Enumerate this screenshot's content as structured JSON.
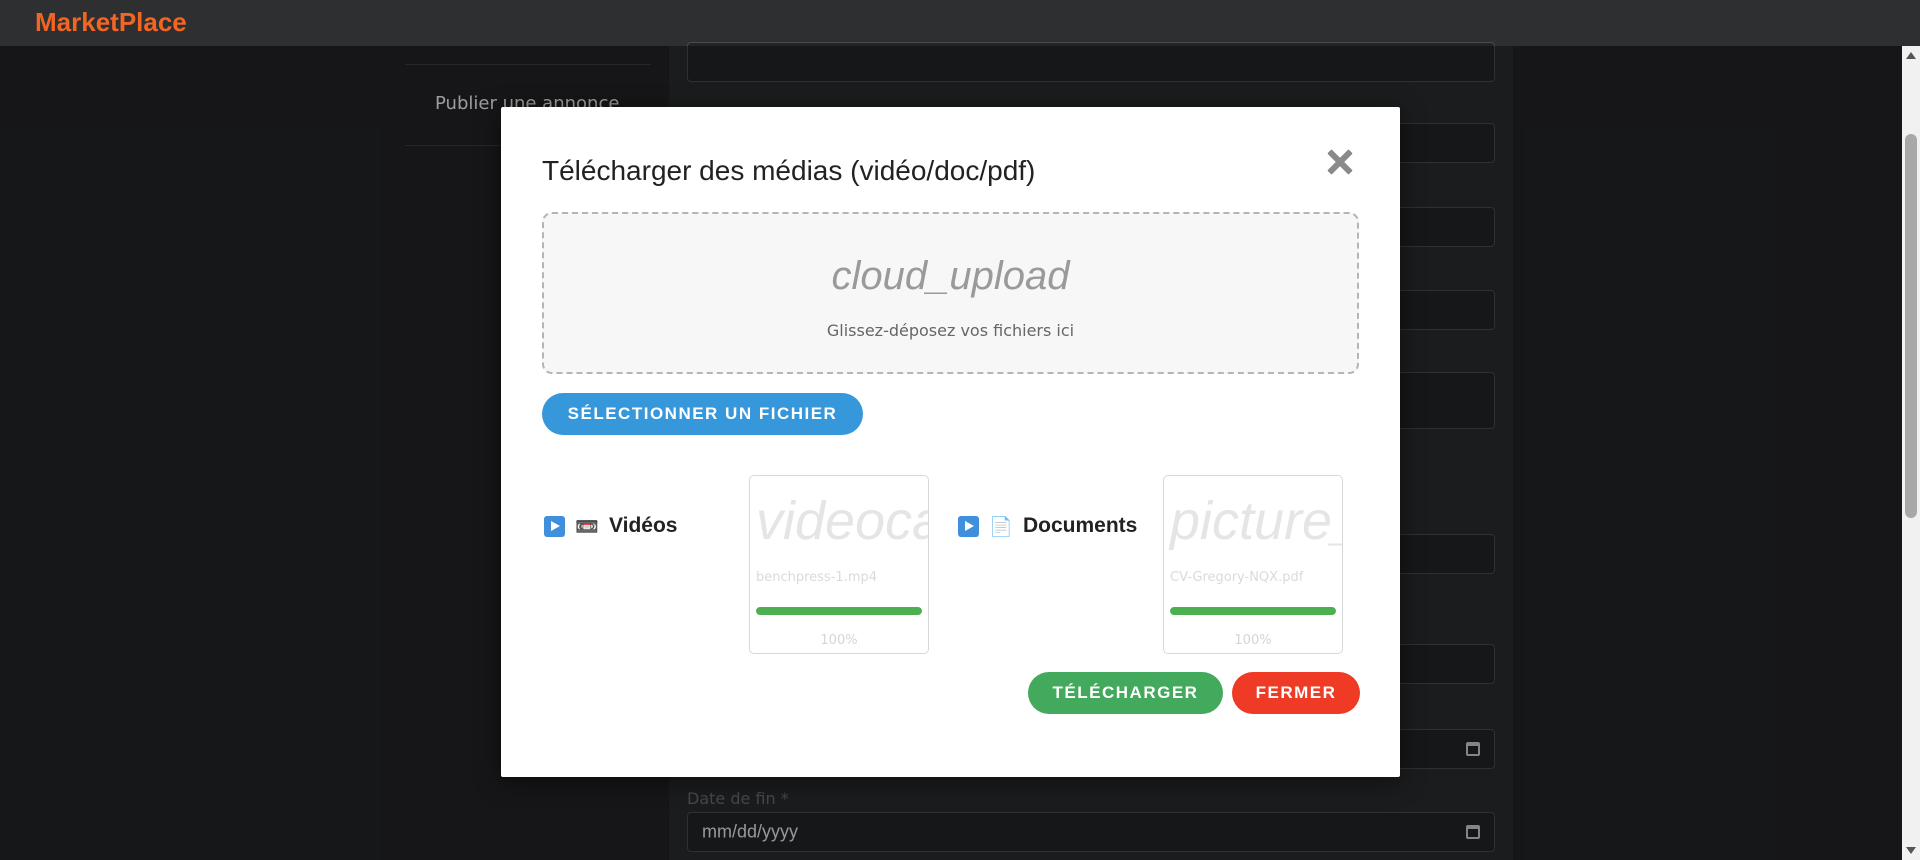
{
  "app": {
    "brand": "MarketPlace"
  },
  "sidebar": {
    "items": [
      {
        "label": "Publier une annonce"
      }
    ]
  },
  "form": {
    "end_date_label": "Date de fin *",
    "end_date_placeholder": "mm/dd/yyyy"
  },
  "modal": {
    "title": "Télécharger des médias (vidéo/doc/pdf)",
    "dropzone": {
      "icon_text": "cloud_upload",
      "hint": "Glissez-déposez vos fichiers ici"
    },
    "select_button": "SÉLECTIONNER UN FICHIER",
    "groups": [
      {
        "label": "Vidéos",
        "icon": "videocassette-icon",
        "file": {
          "icon_text": "videocam",
          "name": "benchpress-1.mp4",
          "progress": 100,
          "progress_text": "100%"
        }
      },
      {
        "label": "Documents",
        "icon": "document-icon",
        "file": {
          "icon_text": "picture_as_pdf",
          "name": "CV-Gregory-NQX.pdf",
          "progress": 100,
          "progress_text": "100%"
        }
      }
    ],
    "upload_button": "TÉLÉCHARGER",
    "close_button": "FERMER"
  },
  "colors": {
    "brand": "#f26522",
    "select_button": "#3697db",
    "upload_button": "#43aa5d",
    "close_button": "#ef3b25",
    "progress": "#4caf50"
  }
}
